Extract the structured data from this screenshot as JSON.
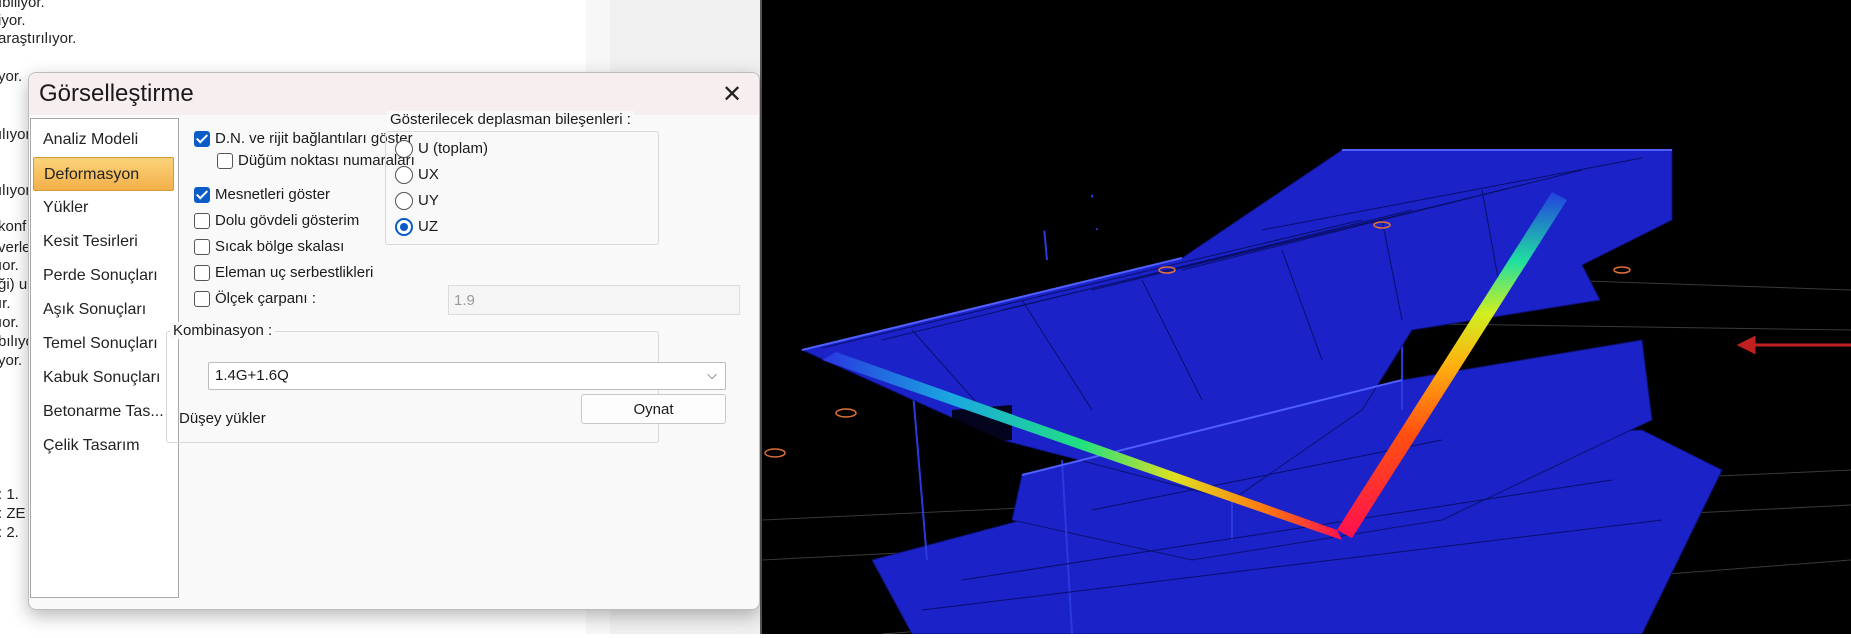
{
  "log": {
    "lines": [
      "ıbiliyor.",
      "iyor.",
      "araştırılıyor.",
      "yor.",
      "ılıyor",
      "ılıyor",
      "konf",
      "verle",
      "ıor.",
      "ği) u",
      "ır.",
      "ıor.",
      "bılıyo",
      "yor.",
      ": 1.",
      ": ZE",
      ": 2."
    ]
  },
  "dialog": {
    "title": "Görselleştirme",
    "close_glyph": "✕",
    "nav": {
      "items": [
        "Analiz Modeli",
        "Deformasyon",
        "Yükler",
        "Kesit Tesirleri",
        "Perde Sonuçları",
        "Aşık Sonuçları",
        "Temel Sonuçları",
        "Kabuk Sonuçları",
        "Betonarme Tas...",
        "Çelik Tasarım"
      ],
      "selected": "Deformasyon"
    },
    "options": {
      "show_nodes": {
        "label": "D.N. ve rijit bağlantıları göster",
        "checked": true
      },
      "node_numbers": {
        "label": "Düğüm noktası numaraları",
        "checked": false
      },
      "show_supports": {
        "label": "Mesnetleri göster",
        "checked": true
      },
      "solid_body": {
        "label": "Dolu gövdeli gösterim",
        "checked": false
      },
      "heat_scale": {
        "label": "Sıcak bölge skalası",
        "checked": false
      },
      "end_releases": {
        "label": "Eleman uç serbestlikleri",
        "checked": false
      },
      "scale_factor": {
        "label": "Ölçek çarpanı :",
        "checked": false,
        "value": "1.9"
      }
    },
    "displacement": {
      "legend": "Gösterilecek deplasman bileşenleri :",
      "options": [
        "U (toplam)",
        "UX",
        "UY",
        "UZ"
      ],
      "selected": "UZ"
    },
    "combination": {
      "legend": "Kombinasyon :",
      "value": "1.4G+1.6Q",
      "chevron": "⌵",
      "play_label": "Oynat",
      "description": "Düşey yükler"
    }
  },
  "colors": {
    "accent": "#0b5cc7",
    "selected_nav": "#f3b04a",
    "viewport_bg": "#000000",
    "mesh_blue": "#1a22c8"
  }
}
